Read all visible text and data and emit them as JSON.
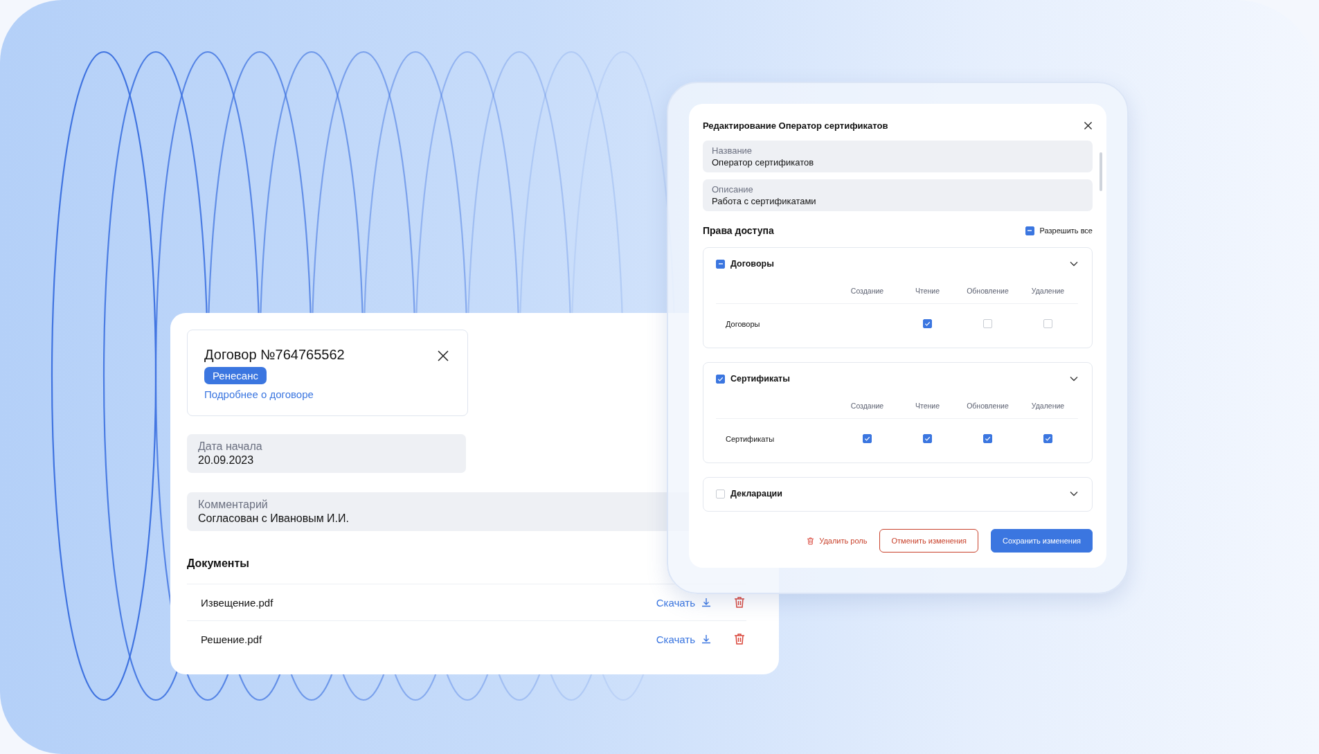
{
  "contract_card": {
    "title": "Договор №764765562",
    "tag": "Ренесанс",
    "link": "Подробнее о договоре",
    "fields": [
      {
        "label": "Дата начала",
        "value": "20.09.2023"
      },
      {
        "label": "Комментарий",
        "value": "Согласован с Ивановым И.И."
      }
    ],
    "documents_title": "Документы",
    "documents": [
      {
        "name": "Извещение.pdf",
        "download": "Скачать"
      },
      {
        "name": "Решение.pdf",
        "download": "Скачать"
      }
    ]
  },
  "role_dialog": {
    "title": "Редактирование Оператор сертификатов",
    "fields": [
      {
        "label": "Название",
        "value": "Оператор сертификатов"
      },
      {
        "label": "Описание",
        "value": "Работа с сертификатами"
      }
    ],
    "permissions_title": "Права доступа",
    "allow_all": {
      "label": "Разрешить все",
      "checked": false,
      "indeterminate": true
    },
    "sections": [
      {
        "title": "Договоры",
        "checked": false,
        "indeterminate": true,
        "columns": [
          "Создание",
          "Чтение",
          "Обновление",
          "Удаление"
        ],
        "rows": [
          {
            "name": "Договоры",
            "cells": [
              {
                "kind": "blank"
              },
              {
                "kind": "checkbox",
                "checked": true
              },
              {
                "kind": "checkbox",
                "checked": false
              },
              {
                "kind": "checkbox",
                "checked": false
              }
            ]
          }
        ]
      },
      {
        "title": "Сертификаты",
        "checked": true,
        "indeterminate": false,
        "columns": [
          "Создание",
          "Чтение",
          "Обновление",
          "Удаление"
        ],
        "rows": [
          {
            "name": "Сертификаты",
            "cells": [
              {
                "kind": "checkbox",
                "checked": true
              },
              {
                "kind": "checkbox",
                "checked": true
              },
              {
                "kind": "checkbox",
                "checked": true
              },
              {
                "kind": "checkbox",
                "checked": true
              }
            ]
          }
        ]
      },
      {
        "title": "Декларации",
        "checked": false,
        "indeterminate": false
      }
    ],
    "buttons": [
      {
        "kind": "delete",
        "label": "Удалить роль"
      },
      {
        "kind": "cancel",
        "label": "Отменить изменения"
      },
      {
        "kind": "save",
        "label": "Сохранить изменения"
      }
    ]
  }
}
